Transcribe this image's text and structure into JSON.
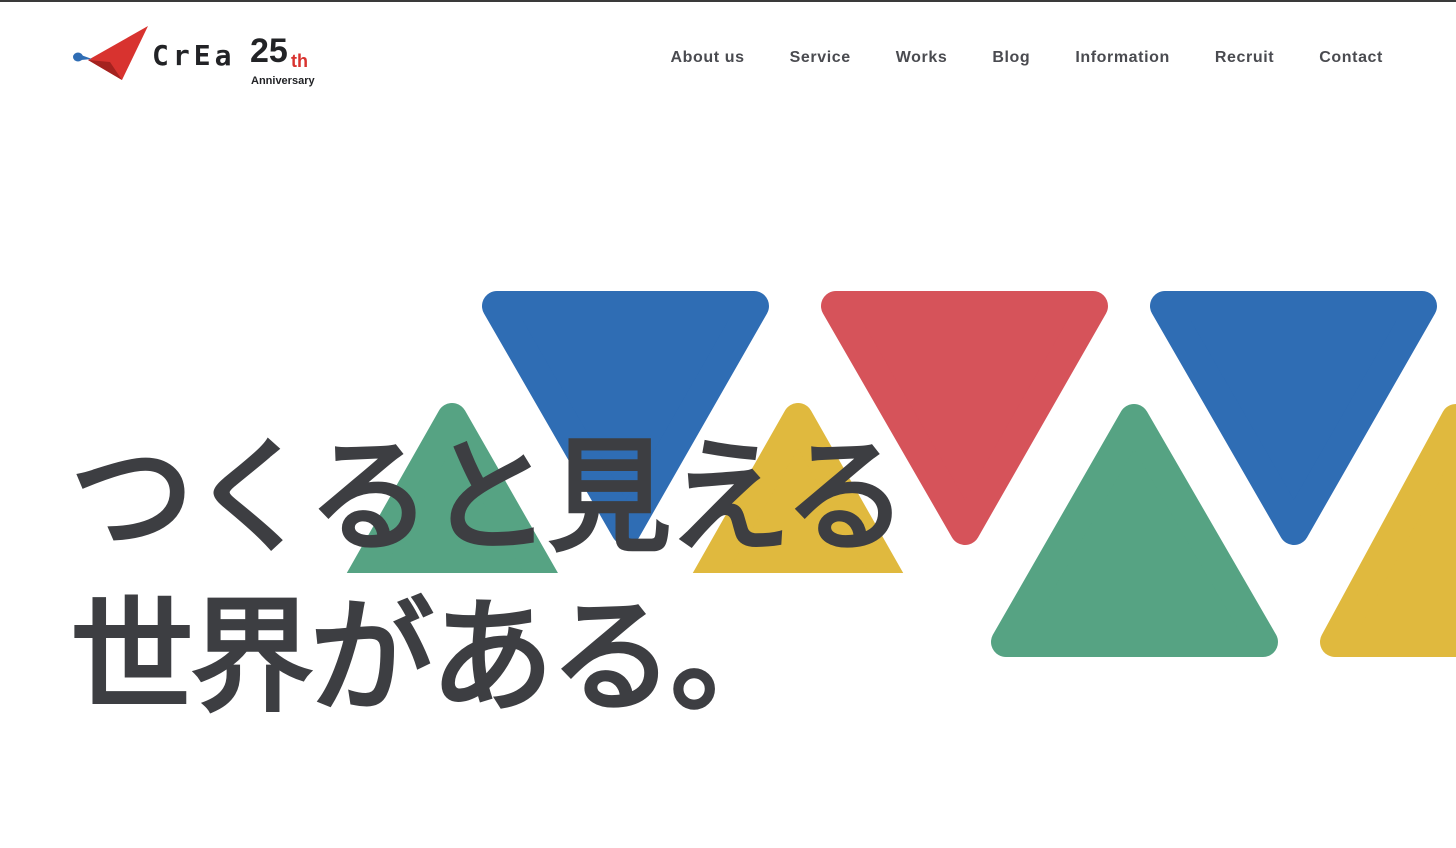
{
  "brand": {
    "name": "CrEa",
    "anniversary_number": "25",
    "anniversary_suffix": "th",
    "anniversary_word": "Anniversary",
    "logo_icon": "paper-plane-icon"
  },
  "nav": {
    "items": [
      {
        "label": "About us"
      },
      {
        "label": "Service"
      },
      {
        "label": "Works"
      },
      {
        "label": "Blog"
      },
      {
        "label": "Information"
      },
      {
        "label": "Recruit"
      },
      {
        "label": "Contact"
      }
    ]
  },
  "hero": {
    "headline_line1": "つくると見える",
    "headline_line2": "世界がある。"
  },
  "colors": {
    "blue": "#2f6db4",
    "red": "#d6535a",
    "green": "#56a383",
    "yellow": "#e0b93e",
    "text": "#3d3e42",
    "logo_red": "#d8332f",
    "logo_blue": "#2f6db4"
  }
}
